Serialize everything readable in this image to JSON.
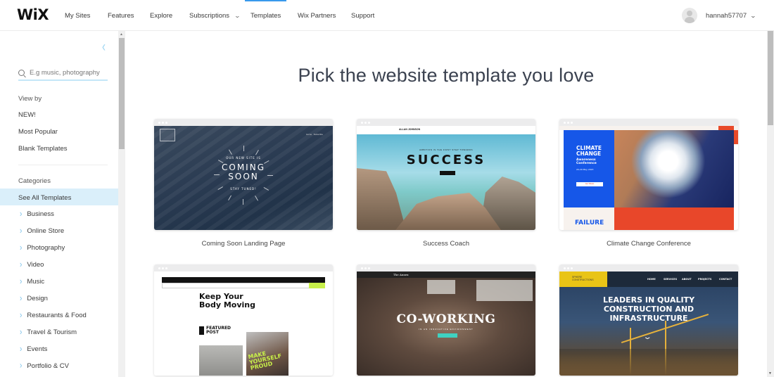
{
  "topbar": {
    "logo": "WiX",
    "nav": [
      {
        "label": "My Sites"
      },
      {
        "label": "Features"
      },
      {
        "label": "Explore"
      },
      {
        "label": "Subscriptions",
        "has_dropdown": true
      },
      {
        "label": "Templates",
        "active": true
      },
      {
        "label": "Wix Partners"
      },
      {
        "label": "Support"
      }
    ],
    "user": {
      "name": "hannah57707"
    }
  },
  "sidebar": {
    "search_placeholder": "E.g music, photography",
    "view_by": {
      "heading": "View by",
      "items": [
        {
          "label": "NEW!"
        },
        {
          "label": "Most Popular"
        },
        {
          "label": "Blank Templates"
        }
      ]
    },
    "categories": {
      "heading": "Categories",
      "selected": "See All Templates",
      "items": [
        {
          "label": "Business"
        },
        {
          "label": "Online Store"
        },
        {
          "label": "Photography"
        },
        {
          "label": "Video"
        },
        {
          "label": "Music"
        },
        {
          "label": "Design"
        },
        {
          "label": "Restaurants & Food"
        },
        {
          "label": "Travel & Tourism"
        },
        {
          "label": "Events"
        },
        {
          "label": "Portfolio & CV"
        }
      ]
    }
  },
  "main": {
    "headline": "Pick the website template you love",
    "templates": [
      {
        "name": "Coming Soon Landing Page",
        "preview": {
          "line1": "OUR NEW SITE IS",
          "title": "COMING SOON",
          "line2": "STAY TUNED!"
        }
      },
      {
        "name": "Success Coach",
        "preview": {
          "brand": "ALLAN JOHNSON",
          "title": "SUCCESS",
          "tagline": "AMBITION IS THE FIRST STEP TOWARDS"
        }
      },
      {
        "name": "Climate Change Conference",
        "preview": {
          "title": "CLIMATE CHANGE",
          "subtitle": "Awareness Conference",
          "date": "20-29 May 2023",
          "button": "Get Tickets",
          "footer": "FAILURE"
        }
      },
      {
        "name": "",
        "preview": {
          "title": "Keep Your Body Moving",
          "featured": "FEATURED POST",
          "overlay": "MAKE YOURSELF PROUD"
        }
      },
      {
        "name": "",
        "preview": {
          "brand": "The Annex",
          "title": "CO-WORKING",
          "tagline": "IN AN INNOVATIVE ENVIRONMENT"
        }
      },
      {
        "name": "",
        "preview": {
          "brand": "SPHERE CONSTRUCTIONS",
          "nav": [
            "HOME",
            "SERVICES",
            "ABOUT",
            "PROJECTS",
            "CONTACT"
          ],
          "title": "LEADERS IN QUALITY CONSTRUCTION AND INFRASTRUCTURE"
        }
      }
    ]
  }
}
